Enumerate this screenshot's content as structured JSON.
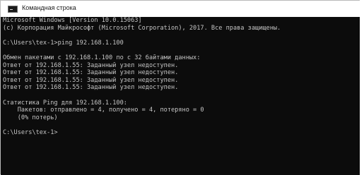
{
  "window": {
    "title": "Командная строка",
    "icon": "cmd-icon"
  },
  "console": {
    "colors": {
      "background": "#0c0c0c",
      "text": "#c6c6c6"
    },
    "lines": [
      "Microsoft Windows [Version 10.0.15063]",
      "(c) Корпорация Майкрософт (Microsoft Corporation), 2017. Все права защищены.",
      "",
      "C:\\Users\\tex-1>ping 192.168.1.100",
      "",
      "Обмен пакетами с 192.168.1.100 по с 32 байтами данных:",
      "Ответ от 192.168.1.55: Заданный узел недоступен.",
      "Ответ от 192.168.1.55: Заданный узел недоступен.",
      "Ответ от 192.168.1.55: Заданный узел недоступен.",
      "Ответ от 192.168.1.55: Заданный узел недоступен.",
      "",
      "Статистика Ping для 192.168.1.100:",
      "    Пакетов: отправлено = 4, получено = 4, потеряно = 0",
      "    (0% потерь)",
      "",
      "C:\\Users\\tex-1>"
    ]
  }
}
